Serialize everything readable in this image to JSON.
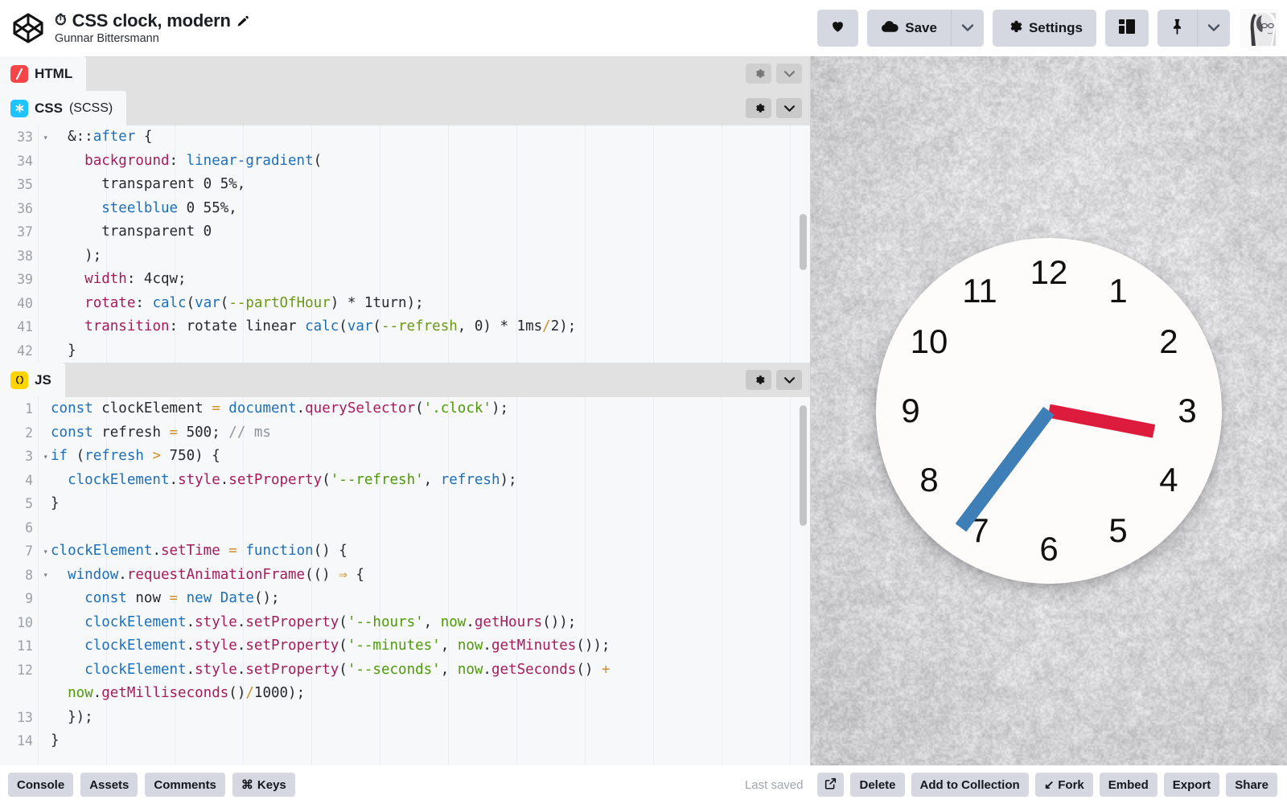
{
  "header": {
    "logo_icon": "codepen-logo-icon",
    "title": "CSS clock, modern",
    "title_emoji": "⏱",
    "edit_icon": "pencil-icon",
    "author": "Gunnar Bittersmann",
    "buttons": {
      "love": "",
      "love_icon": "heart-icon",
      "save": "Save",
      "save_icon": "cloud-icon",
      "save_caret_icon": "chevron-down-icon",
      "settings": "Settings",
      "settings_icon": "gear-icon",
      "layout_icon": "layout-panels-icon",
      "pin_icon": "pin-icon",
      "pin_caret_icon": "chevron-down-icon",
      "avatar_alt": "user-avatar"
    }
  },
  "editors": [
    {
      "id": "html",
      "label": "HTML",
      "sublabel": "",
      "chip": "/",
      "gear_icon": "gear-icon",
      "collapse_icon": "chevron-down-icon"
    },
    {
      "id": "css",
      "label": "CSS",
      "sublabel": "(SCSS)",
      "chip": "✳",
      "gear_icon": "gear-icon",
      "collapse_icon": "chevron-down-icon",
      "lines": [
        {
          "n": "33",
          "fold": true,
          "tokens": [
            {
              "t": "  ",
              "c": "n"
            },
            {
              "t": "&",
              "c": "n"
            },
            {
              "t": "::",
              "c": "n"
            },
            {
              "t": "after",
              "c": "k"
            },
            {
              "t": " {",
              "c": "n"
            }
          ]
        },
        {
          "n": "34",
          "fold": false,
          "tokens": [
            {
              "t": "    ",
              "c": "n"
            },
            {
              "t": "background",
              "c": "p"
            },
            {
              "t": ": ",
              "c": "n"
            },
            {
              "t": "linear-gradient",
              "c": "k"
            },
            {
              "t": "(",
              "c": "n"
            }
          ]
        },
        {
          "n": "35",
          "fold": false,
          "tokens": [
            {
              "t": "      transparent 0 5%,",
              "c": "n"
            }
          ]
        },
        {
          "n": "36",
          "fold": false,
          "tokens": [
            {
              "t": "      ",
              "c": "n"
            },
            {
              "t": "steelblue",
              "c": "k"
            },
            {
              "t": " 0 55%,",
              "c": "n"
            }
          ]
        },
        {
          "n": "37",
          "fold": false,
          "tokens": [
            {
              "t": "      transparent 0",
              "c": "n"
            }
          ]
        },
        {
          "n": "38",
          "fold": false,
          "tokens": [
            {
              "t": "    );",
              "c": "n"
            }
          ]
        },
        {
          "n": "39",
          "fold": false,
          "tokens": [
            {
              "t": "    ",
              "c": "n"
            },
            {
              "t": "width",
              "c": "p"
            },
            {
              "t": ": 4cqw;",
              "c": "n"
            }
          ]
        },
        {
          "n": "40",
          "fold": false,
          "tokens": [
            {
              "t": "    ",
              "c": "n"
            },
            {
              "t": "rotate",
              "c": "p"
            },
            {
              "t": ": ",
              "c": "n"
            },
            {
              "t": "calc",
              "c": "k"
            },
            {
              "t": "(",
              "c": "n"
            },
            {
              "t": "var",
              "c": "k"
            },
            {
              "t": "(",
              "c": "n"
            },
            {
              "t": "--partOfHour",
              "c": "v"
            },
            {
              "t": ") * 1turn);",
              "c": "n"
            }
          ]
        },
        {
          "n": "41",
          "fold": false,
          "tokens": [
            {
              "t": "    ",
              "c": "n"
            },
            {
              "t": "transition",
              "c": "p"
            },
            {
              "t": ": rotate linear ",
              "c": "n"
            },
            {
              "t": "calc",
              "c": "k"
            },
            {
              "t": "(",
              "c": "n"
            },
            {
              "t": "var",
              "c": "k"
            },
            {
              "t": "(",
              "c": "n"
            },
            {
              "t": "--refresh",
              "c": "v"
            },
            {
              "t": ", 0) * 1ms",
              "c": "n"
            },
            {
              "t": "/",
              "c": "o"
            },
            {
              "t": "2);",
              "c": "n"
            }
          ]
        },
        {
          "n": "42",
          "fold": false,
          "tokens": [
            {
              "t": "  }",
              "c": "n"
            }
          ]
        }
      ]
    },
    {
      "id": "js",
      "label": "JS",
      "sublabel": "",
      "chip": "()",
      "gear_icon": "gear-icon",
      "collapse_icon": "chevron-down-icon",
      "lines": [
        {
          "n": "1",
          "fold": false,
          "tokens": [
            {
              "t": "const",
              "c": "k"
            },
            {
              "t": " clockElement ",
              "c": "n"
            },
            {
              "t": "=",
              "c": "o"
            },
            {
              "t": " ",
              "c": "n"
            },
            {
              "t": "document",
              "c": "k"
            },
            {
              "t": ".",
              "c": "n"
            },
            {
              "t": "querySelector",
              "c": "p"
            },
            {
              "t": "(",
              "c": "n"
            },
            {
              "t": "'.clock'",
              "c": "s"
            },
            {
              "t": ");",
              "c": "n"
            }
          ]
        },
        {
          "n": "2",
          "fold": false,
          "tokens": [
            {
              "t": "const",
              "c": "k"
            },
            {
              "t": " refresh ",
              "c": "n"
            },
            {
              "t": "=",
              "c": "o"
            },
            {
              "t": " 500; ",
              "c": "n"
            },
            {
              "t": "// ms",
              "c": "c"
            }
          ]
        },
        {
          "n": "3",
          "fold": true,
          "tokens": [
            {
              "t": "if",
              "c": "k"
            },
            {
              "t": " (",
              "c": "n"
            },
            {
              "t": "refresh",
              "c": "k"
            },
            {
              "t": " ",
              "c": "n"
            },
            {
              "t": ">",
              "c": "o"
            },
            {
              "t": " 750) {",
              "c": "n"
            }
          ]
        },
        {
          "n": "4",
          "fold": false,
          "tokens": [
            {
              "t": "  ",
              "c": "n"
            },
            {
              "t": "clockElement",
              "c": "k"
            },
            {
              "t": ".",
              "c": "n"
            },
            {
              "t": "style",
              "c": "p"
            },
            {
              "t": ".",
              "c": "n"
            },
            {
              "t": "setProperty",
              "c": "p"
            },
            {
              "t": "(",
              "c": "n"
            },
            {
              "t": "'--refresh'",
              "c": "s"
            },
            {
              "t": ", ",
              "c": "n"
            },
            {
              "t": "refresh",
              "c": "k"
            },
            {
              "t": ");",
              "c": "n"
            }
          ]
        },
        {
          "n": "5",
          "fold": false,
          "tokens": [
            {
              "t": "}",
              "c": "n"
            }
          ]
        },
        {
          "n": "6",
          "fold": false,
          "tokens": [
            {
              "t": "",
              "c": "n"
            }
          ]
        },
        {
          "n": "7",
          "fold": true,
          "tokens": [
            {
              "t": "clockElement",
              "c": "k"
            },
            {
              "t": ".",
              "c": "n"
            },
            {
              "t": "setTime",
              "c": "p"
            },
            {
              "t": " ",
              "c": "n"
            },
            {
              "t": "=",
              "c": "o"
            },
            {
              "t": " ",
              "c": "n"
            },
            {
              "t": "function",
              "c": "k"
            },
            {
              "t": "() {",
              "c": "n"
            }
          ]
        },
        {
          "n": "8",
          "fold": true,
          "tokens": [
            {
              "t": "  ",
              "c": "n"
            },
            {
              "t": "window",
              "c": "k"
            },
            {
              "t": ".",
              "c": "n"
            },
            {
              "t": "requestAnimationFrame",
              "c": "p"
            },
            {
              "t": "(() ",
              "c": "n"
            },
            {
              "t": "⇒",
              "c": "o"
            },
            {
              "t": " {",
              "c": "n"
            }
          ]
        },
        {
          "n": "9",
          "fold": false,
          "tokens": [
            {
              "t": "    ",
              "c": "n"
            },
            {
              "t": "const",
              "c": "k"
            },
            {
              "t": " now ",
              "c": "n"
            },
            {
              "t": "=",
              "c": "o"
            },
            {
              "t": " ",
              "c": "n"
            },
            {
              "t": "new",
              "c": "k"
            },
            {
              "t": " ",
              "c": "n"
            },
            {
              "t": "Date",
              "c": "k"
            },
            {
              "t": "();",
              "c": "n"
            }
          ]
        },
        {
          "n": "10",
          "fold": false,
          "tokens": [
            {
              "t": "    ",
              "c": "n"
            },
            {
              "t": "clockElement",
              "c": "k"
            },
            {
              "t": ".",
              "c": "n"
            },
            {
              "t": "style",
              "c": "p"
            },
            {
              "t": ".",
              "c": "n"
            },
            {
              "t": "setProperty",
              "c": "p"
            },
            {
              "t": "(",
              "c": "n"
            },
            {
              "t": "'--hours'",
              "c": "s"
            },
            {
              "t": ", ",
              "c": "n"
            },
            {
              "t": "now",
              "c": "s"
            },
            {
              "t": ".",
              "c": "n"
            },
            {
              "t": "getHours",
              "c": "p"
            },
            {
              "t": "());",
              "c": "n"
            }
          ]
        },
        {
          "n": "11",
          "fold": false,
          "tokens": [
            {
              "t": "    ",
              "c": "n"
            },
            {
              "t": "clockElement",
              "c": "k"
            },
            {
              "t": ".",
              "c": "n"
            },
            {
              "t": "style",
              "c": "p"
            },
            {
              "t": ".",
              "c": "n"
            },
            {
              "t": "setProperty",
              "c": "p"
            },
            {
              "t": "(",
              "c": "n"
            },
            {
              "t": "'--minutes'",
              "c": "s"
            },
            {
              "t": ", ",
              "c": "n"
            },
            {
              "t": "now",
              "c": "s"
            },
            {
              "t": ".",
              "c": "n"
            },
            {
              "t": "getMinutes",
              "c": "p"
            },
            {
              "t": "());",
              "c": "n"
            }
          ]
        },
        {
          "n": "12",
          "fold": false,
          "tokens": [
            {
              "t": "    ",
              "c": "n"
            },
            {
              "t": "clockElement",
              "c": "k"
            },
            {
              "t": ".",
              "c": "n"
            },
            {
              "t": "style",
              "c": "p"
            },
            {
              "t": ".",
              "c": "n"
            },
            {
              "t": "setProperty",
              "c": "p"
            },
            {
              "t": "(",
              "c": "n"
            },
            {
              "t": "'--seconds'",
              "c": "s"
            },
            {
              "t": ", ",
              "c": "n"
            },
            {
              "t": "now",
              "c": "s"
            },
            {
              "t": ".",
              "c": "n"
            },
            {
              "t": "getSeconds",
              "c": "p"
            },
            {
              "t": "() ",
              "c": "n"
            },
            {
              "t": "+",
              "c": "o"
            }
          ]
        },
        {
          "n": "",
          "fold": false,
          "tokens": [
            {
              "t": "  ",
              "c": "n"
            },
            {
              "t": "now",
              "c": "s"
            },
            {
              "t": ".",
              "c": "n"
            },
            {
              "t": "getMilliseconds",
              "c": "p"
            },
            {
              "t": "()",
              "c": "n"
            },
            {
              "t": "/",
              "c": "o"
            },
            {
              "t": "1000);",
              "c": "n"
            }
          ]
        },
        {
          "n": "13",
          "fold": false,
          "tokens": [
            {
              "t": "  });",
              "c": "n"
            }
          ]
        },
        {
          "n": "14",
          "fold": false,
          "tokens": [
            {
              "t": "}",
              "c": "n"
            }
          ]
        }
      ]
    }
  ],
  "preview": {
    "clock": {
      "numerals": [
        "12",
        "1",
        "2",
        "3",
        "4",
        "5",
        "6",
        "7",
        "8",
        "9",
        "10",
        "11"
      ],
      "hour_hand_color": "#dd1b3c",
      "minute_hand_color": "#3f7fb8",
      "face_color": "#fdfcfa",
      "hour_hand_angle": 101,
      "minute_hand_angle": 217
    }
  },
  "footer": {
    "left_buttons": [
      {
        "label": "Console",
        "icon": ""
      },
      {
        "label": "Assets",
        "icon": ""
      },
      {
        "label": "Comments",
        "icon": ""
      },
      {
        "label": "Keys",
        "icon": "⌘"
      }
    ],
    "status": "Last saved",
    "right_buttons": [
      {
        "label": "",
        "icon": "external-link-icon"
      },
      {
        "label": "Delete",
        "icon": ""
      },
      {
        "label": "Add to Collection",
        "icon": ""
      },
      {
        "label": "Fork",
        "icon": "↘"
      },
      {
        "label": "Embed",
        "icon": ""
      },
      {
        "label": "Export",
        "icon": ""
      },
      {
        "label": "Share",
        "icon": ""
      }
    ]
  }
}
